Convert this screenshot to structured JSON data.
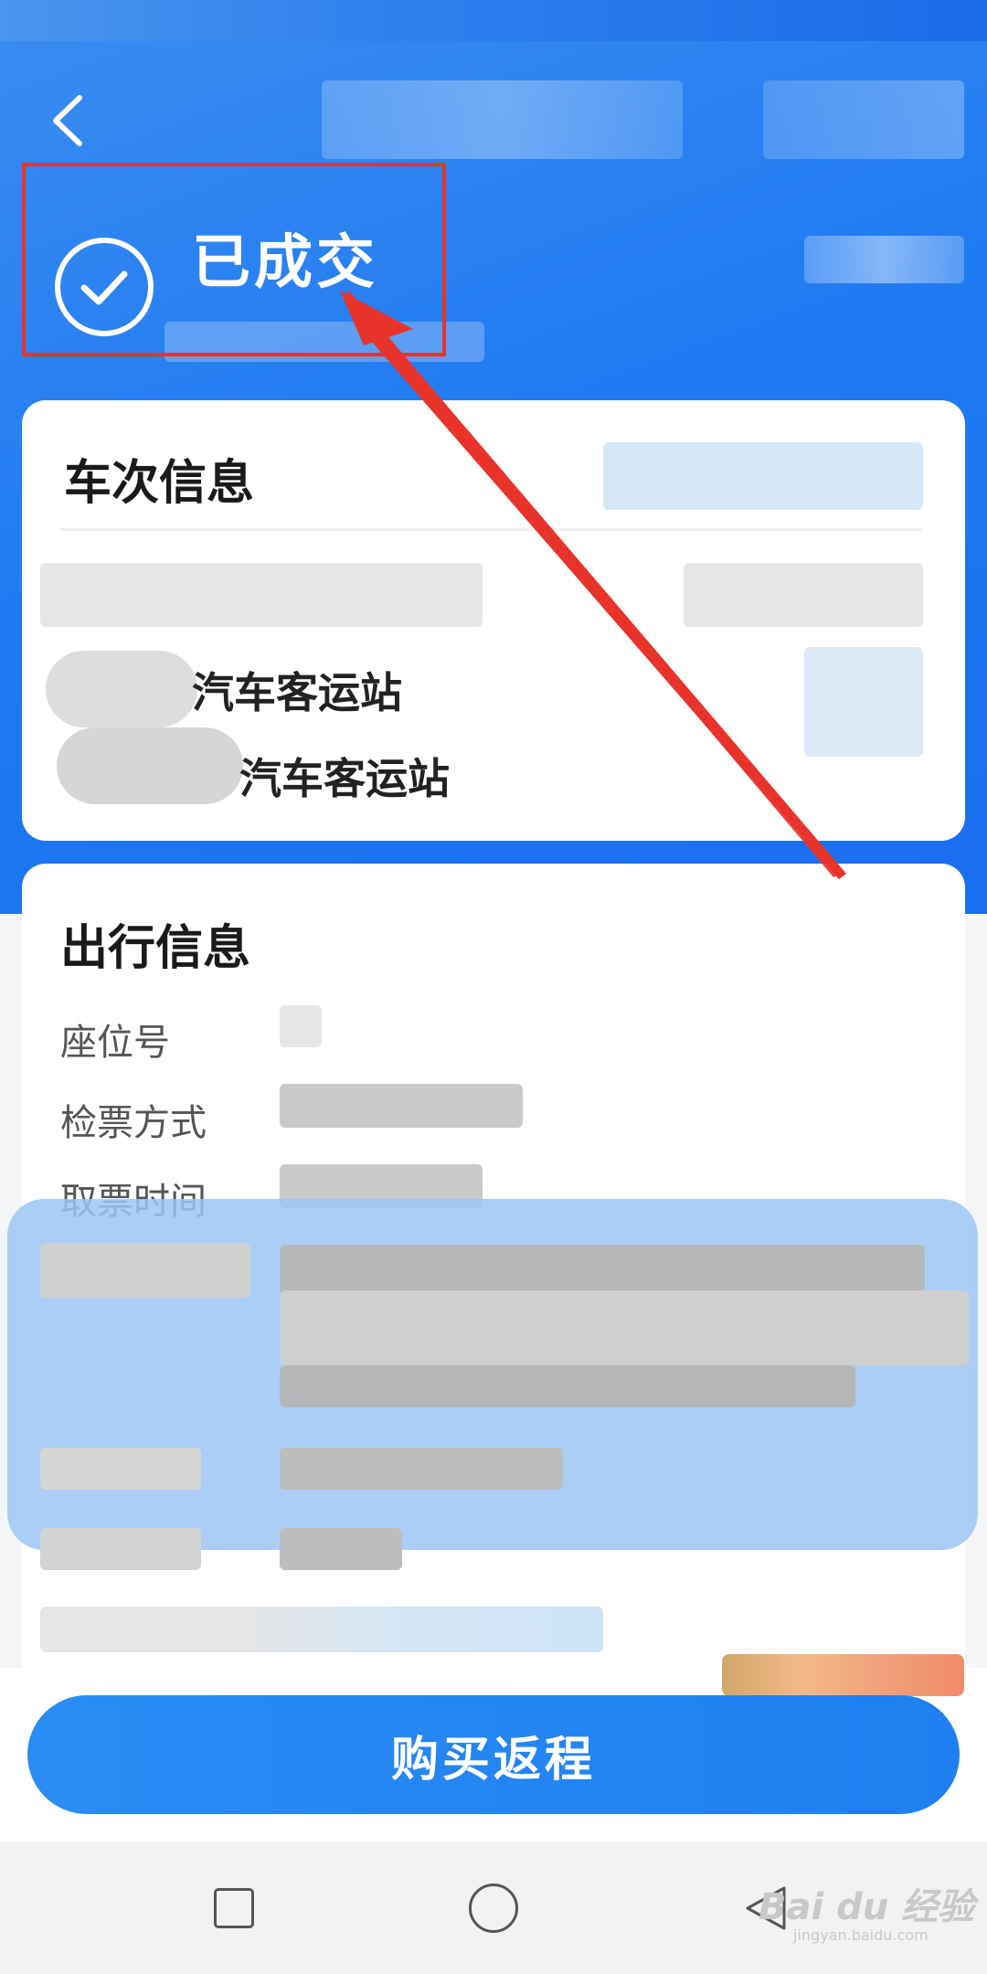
{
  "order_status": {
    "title": "已成交"
  },
  "trip_info": {
    "title": "车次信息",
    "departure_station_suffix": "汽车客运站",
    "arrival_station_suffix": "汽车客运站"
  },
  "travel_info": {
    "title": "出行信息",
    "fields": [
      {
        "label": "座位号"
      },
      {
        "label": "检票方式"
      },
      {
        "label": "取票时间"
      }
    ]
  },
  "actions": {
    "buy_return_label": "购买返程"
  },
  "watermark": {
    "brand": "Bai du 经验",
    "url": "jingyan.baidu.com"
  },
  "colors": {
    "header_blue": "#1f7af2",
    "highlight_red": "#e8332b",
    "button_blue": "#2a8cf5"
  },
  "icons": {
    "back": "chevron-left-icon",
    "status": "check-circle-icon",
    "nav_recents": "square-icon",
    "nav_home": "circle-icon",
    "nav_back": "triangle-back-icon"
  }
}
